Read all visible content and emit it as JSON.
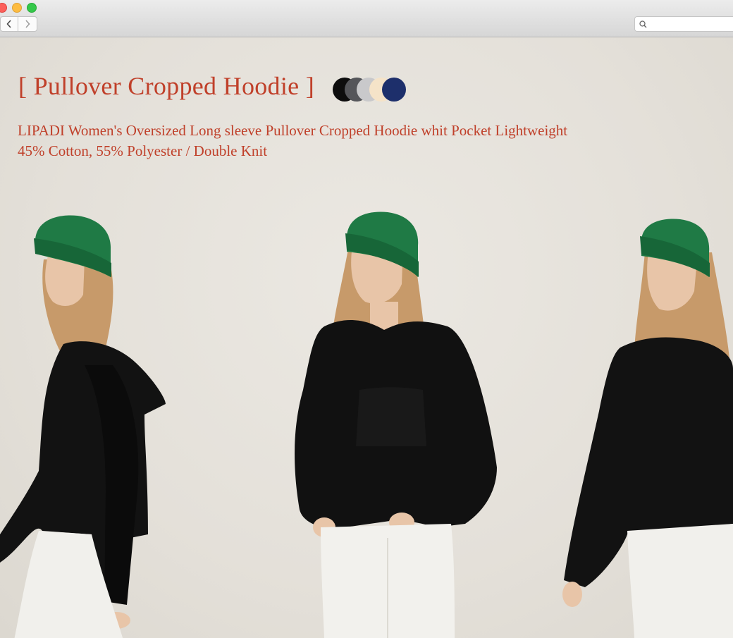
{
  "product": {
    "title": "[ Pullover Cropped Hoodie ]",
    "description_line1": "LIPADI Women's Oversized Long sleeve Pullover Cropped Hoodie whit Pocket Lightweight",
    "description_line2": "45% Cotton, 55% Polyester / Double Knit",
    "colors": [
      {
        "name": "black",
        "hex": "#0d0d0d"
      },
      {
        "name": "dark-gray",
        "hex": "#55565a"
      },
      {
        "name": "light-gray",
        "hex": "#c9c9cb"
      },
      {
        "name": "cream",
        "hex": "#f5e3c8"
      },
      {
        "name": "navy",
        "hex": "#1d2f6b"
      }
    ]
  },
  "theme": {
    "accent": "#c0402a",
    "background": "#e6e2db"
  },
  "icons": {
    "back": "chevron-left-icon",
    "forward": "chevron-right-icon",
    "search": "search-icon"
  }
}
